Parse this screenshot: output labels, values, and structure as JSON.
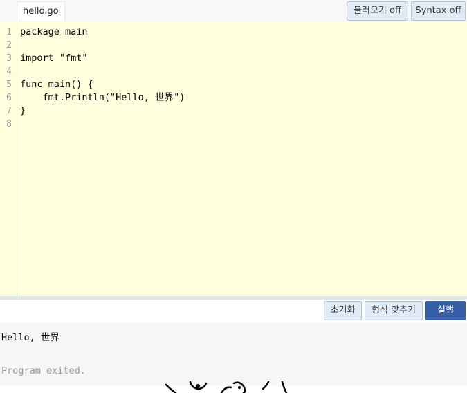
{
  "file_tab": {
    "label": "hello.go"
  },
  "toolbar": {
    "import_label": "불러오기 off",
    "syntax_label": "Syntax off"
  },
  "editor": {
    "line_numbers": [
      "1",
      "2",
      "3",
      "4",
      "5",
      "6",
      "7",
      "8"
    ],
    "lines": [
      "package main",
      "",
      "import \"fmt\"",
      "",
      "func main() {",
      "    fmt.Println(\"Hello, 世界\")",
      "}",
      ""
    ]
  },
  "controls": {
    "reset_label": "초기화",
    "format_label": "형식 맞추기",
    "run_label": "실행"
  },
  "output": {
    "stdout": "Hello, 世界",
    "system": "Program exited."
  },
  "colors": {
    "editor_bg": "#ffffdd",
    "run_button": "#375eab",
    "button_bg": "#e0ebf5",
    "output_bg": "#f6f6f6"
  }
}
